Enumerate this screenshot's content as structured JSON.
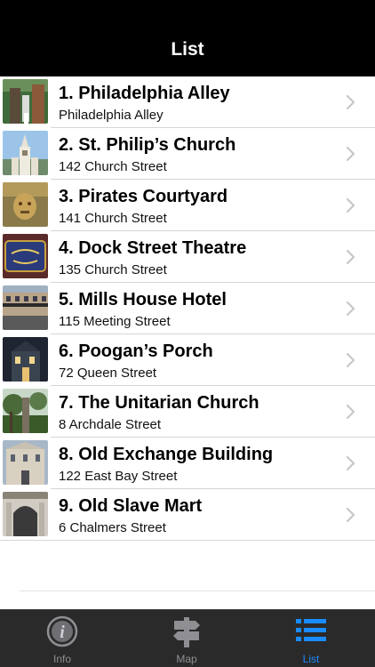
{
  "nav": {
    "title": "List"
  },
  "items": [
    {
      "title": "1. Philadelphia Alley",
      "subtitle": "Philadelphia Alley"
    },
    {
      "title": "2. St. Philip’s Church",
      "subtitle": "142 Church Street"
    },
    {
      "title": "3. Pirates Courtyard",
      "subtitle": "141 Church Street"
    },
    {
      "title": "4. Dock Street Theatre",
      "subtitle": "135 Church Street"
    },
    {
      "title": "5. Mills House Hotel",
      "subtitle": "115 Meeting Street"
    },
    {
      "title": "6. Poogan’s Porch",
      "subtitle": "72 Queen Street"
    },
    {
      "title": "7. The Unitarian Church",
      "subtitle": "8 Archdale Street"
    },
    {
      "title": "8. Old Exchange Building",
      "subtitle": "122 East Bay Street"
    },
    {
      "title": "9. Old Slave Mart",
      "subtitle": "6 Chalmers Street"
    }
  ],
  "tabs": [
    {
      "label": "Info",
      "icon": "info-icon",
      "active": false
    },
    {
      "label": "Map",
      "icon": "signpost-icon",
      "active": false
    },
    {
      "label": "List",
      "icon": "list-icon",
      "active": true
    }
  ],
  "colors": {
    "nav_bg": "#000000",
    "tab_bg": "#2a2a2a",
    "tab_active": "#1a8cff",
    "tab_inactive": "#8e8e93",
    "chevron": "#c7c7cc"
  }
}
